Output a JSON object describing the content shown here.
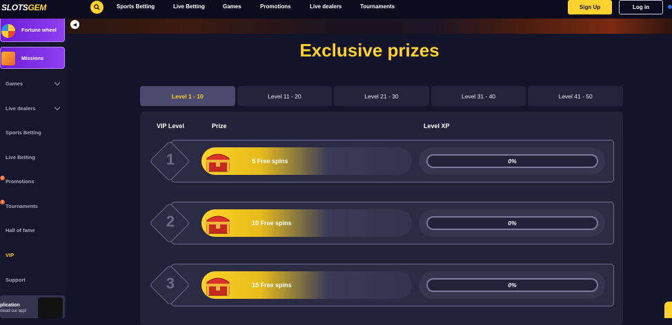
{
  "brand": {
    "logo_left": "SLOTS",
    "logo_right": "GEM"
  },
  "topnav": {
    "items": [
      "Sports Betting",
      "Live Betting",
      "Games",
      "Promotions",
      "Live dealers",
      "Tournaments"
    ],
    "signup": "Sign Up",
    "login": "Log in"
  },
  "sidebar": {
    "promo_wheel": "Fortune wheel",
    "promo_missions": "Missions",
    "items": [
      "Games",
      "Live dealers",
      "Sports Betting",
      "Live Betting",
      "Promotions",
      "Tournaments",
      "Hall of fame",
      "VIP",
      "Support"
    ],
    "active": "VIP",
    "badges": {
      "promotions": "6",
      "tournaments": "2"
    },
    "app_title": "plication",
    "app_sub": "nload our app!"
  },
  "page": {
    "title": "Exclusive prizes",
    "tabs": [
      "Level 1 - 10",
      "Level 11 - 20",
      "Level 21 - 30",
      "Level 31 - 40",
      "Level 41 - 50"
    ],
    "active_tab": 0,
    "columns": {
      "vip_level": "VIP Level",
      "prize": "Prize",
      "level_xp": "Level XP"
    },
    "levels": [
      {
        "level": "1",
        "prize": "5 Free spins",
        "xp": "0%"
      },
      {
        "level": "2",
        "prize": "10 Free spins",
        "xp": "0%"
      },
      {
        "level": "3",
        "prize": "15 Free spins",
        "xp": "0%"
      }
    ]
  },
  "colors": {
    "accent": "#ffd22e",
    "background": "#14142b",
    "panel": "#22223a",
    "missions": "#7b2ee8"
  },
  "icons": [
    "search-icon",
    "chevron-down-icon",
    "collapse-arrow-icon",
    "treasure-chest-icon",
    "wheel-icon",
    "missions-icon"
  ]
}
